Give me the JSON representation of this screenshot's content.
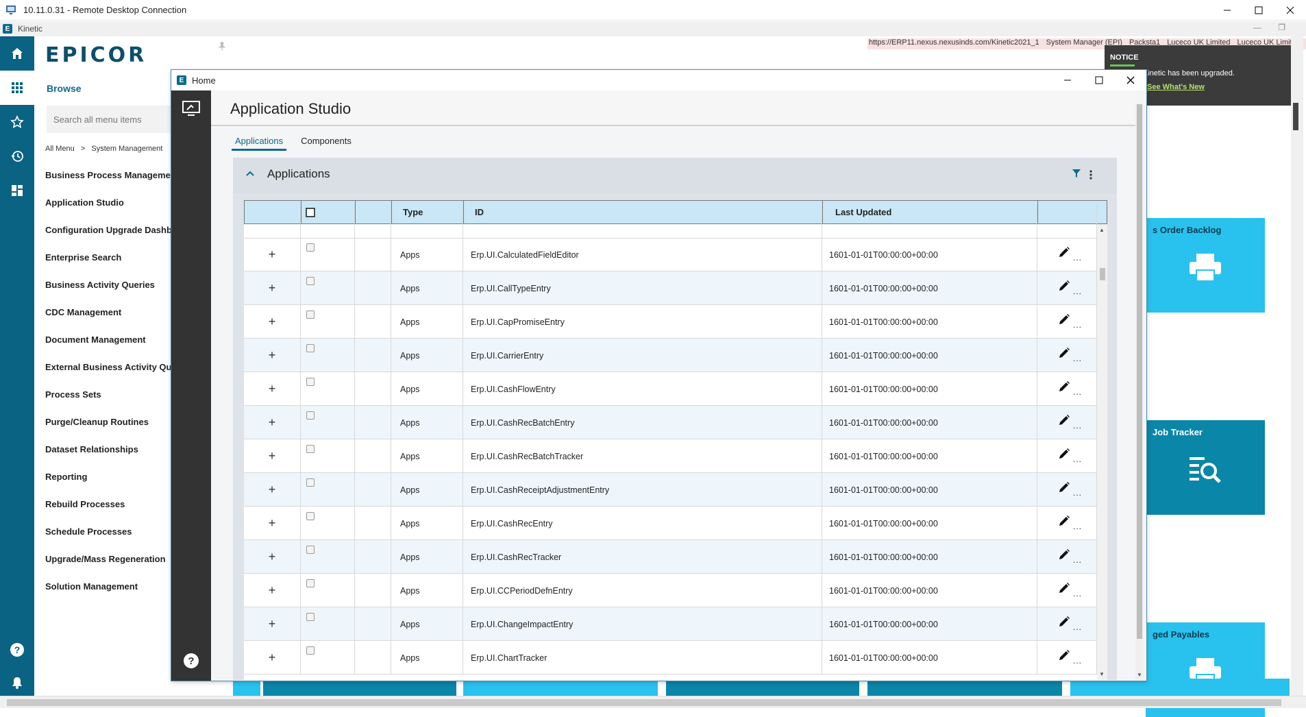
{
  "rdp": {
    "title": "10.11.0.31 - Remote Desktop Connection"
  },
  "kinetic": {
    "title": "Kinetic"
  },
  "browse": {
    "brand": "EPICOR",
    "title": "Browse",
    "search_placeholder": "Search all menu items",
    "breadcrumb": [
      "All Menu",
      ">",
      "System Management"
    ],
    "menu_items": [
      "Business Process Management",
      "Application Studio",
      "Configuration Upgrade Dashboard",
      "Enterprise Search",
      "Business Activity Queries",
      "CDC Management",
      "Document Management",
      "External Business Activity Query",
      "Process Sets",
      "Purge/Cleanup Routines",
      "Dataset Relationships",
      "Reporting",
      "Rebuild Processes",
      "Schedule Processes",
      "Upgrade/Mass Regeneration",
      "Solution Management"
    ]
  },
  "background": {
    "url_info": [
      "https://ERP11.nexus.nexusinds.com/Kinetic2021_1",
      "System Manager (EPI)",
      "Packsta1",
      "Luceco UK Limited",
      "Luceco UK Limit"
    ],
    "notice": {
      "title": "NOTICE",
      "message": "Kinetic has been upgraded.",
      "link": "See What's New"
    },
    "tiles": [
      "s Order Backlog",
      "Job Tracker",
      "ged Payables"
    ]
  },
  "window": {
    "title": "Home"
  },
  "studio": {
    "title": "Application Studio",
    "tabs": [
      "Applications",
      "Components"
    ],
    "panel_title": "Applications",
    "columns": [
      "",
      "",
      "",
      "Type",
      "ID",
      "Last Updated",
      ""
    ],
    "rows": [
      {
        "type": "Apps",
        "id": "Erp.UI.CalculatedFieldEditor",
        "updated": "1601-01-01T00:00:00+00:00"
      },
      {
        "type": "Apps",
        "id": "Erp.UI.CallTypeEntry",
        "updated": "1601-01-01T00:00:00+00:00"
      },
      {
        "type": "Apps",
        "id": "Erp.UI.CapPromiseEntry",
        "updated": "1601-01-01T00:00:00+00:00"
      },
      {
        "type": "Apps",
        "id": "Erp.UI.CarrierEntry",
        "updated": "1601-01-01T00:00:00+00:00"
      },
      {
        "type": "Apps",
        "id": "Erp.UI.CashFlowEntry",
        "updated": "1601-01-01T00:00:00+00:00"
      },
      {
        "type": "Apps",
        "id": "Erp.UI.CashRecBatchEntry",
        "updated": "1601-01-01T00:00:00+00:00"
      },
      {
        "type": "Apps",
        "id": "Erp.UI.CashRecBatchTracker",
        "updated": "1601-01-01T00:00:00+00:00"
      },
      {
        "type": "Apps",
        "id": "Erp.UI.CashReceiptAdjustmentEntry",
        "updated": "1601-01-01T00:00:00+00:00"
      },
      {
        "type": "Apps",
        "id": "Erp.UI.CashRecEntry",
        "updated": "1601-01-01T00:00:00+00:00"
      },
      {
        "type": "Apps",
        "id": "Erp.UI.CashRecTracker",
        "updated": "1601-01-01T00:00:00+00:00"
      },
      {
        "type": "Apps",
        "id": "Erp.UI.CCPeriodDefnEntry",
        "updated": "1601-01-01T00:00:00+00:00"
      },
      {
        "type": "Apps",
        "id": "Erp.UI.ChangeImpactEntry",
        "updated": "1601-01-01T00:00:00+00:00"
      },
      {
        "type": "Apps",
        "id": "Erp.UI.ChartTracker",
        "updated": "1601-01-01T00:00:00+00:00"
      }
    ],
    "expand_symbol": "+",
    "more_symbol": "..."
  },
  "colors": {
    "rail": "#0a6382",
    "accent": "#0b6a8a",
    "tile_light": "#29c2ee",
    "tile_dark": "#0a86a8",
    "grid_header": "#c9e7f6"
  }
}
